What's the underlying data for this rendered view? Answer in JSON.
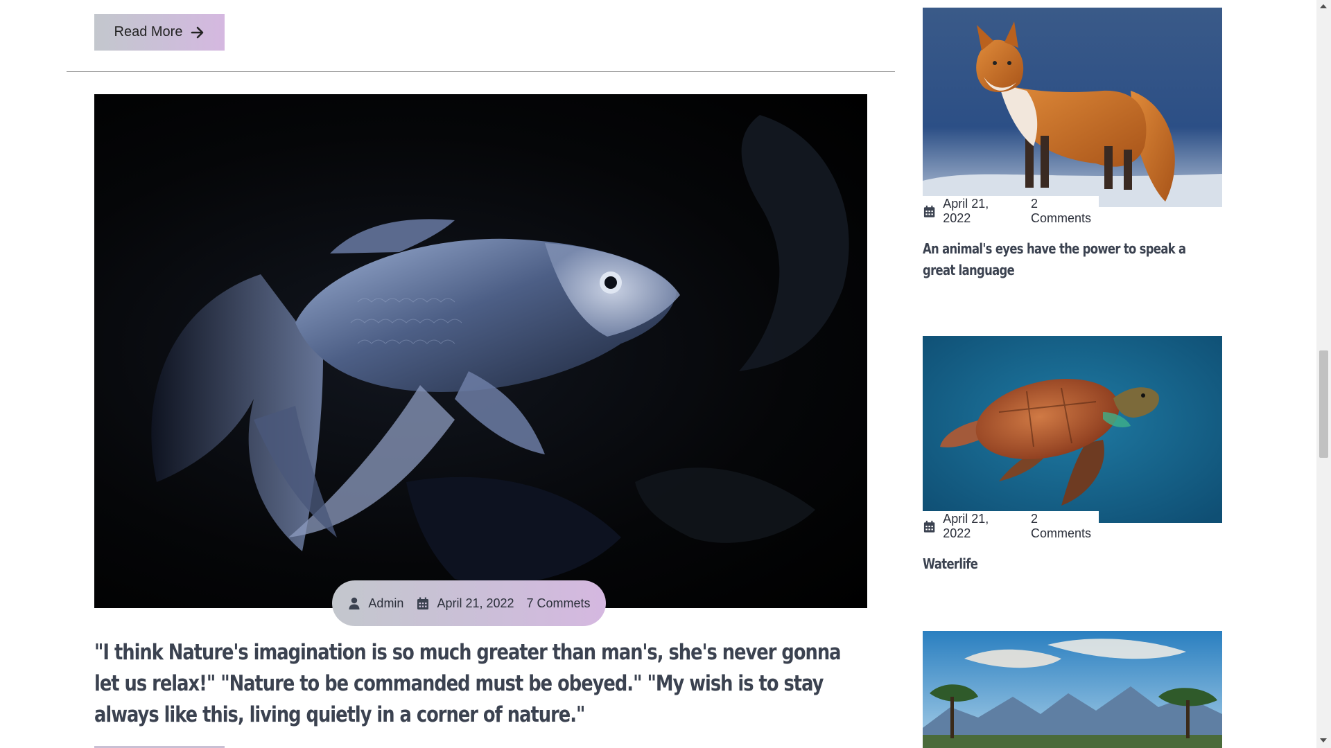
{
  "main": {
    "read_more_label": "Read More",
    "post": {
      "author": "Admin",
      "date": "April 21, 2022",
      "comments": "7 Commets",
      "title": "\"I think Nature's imagination is so much greater than man's, she's never gonna let us relax!\" \"Nature to be commanded must be obeyed.\" \"My wish is to stay always like this, living quietly in a corner of nature.\""
    }
  },
  "sidebar": {
    "cards": [
      {
        "date": "April 21, 2022",
        "comments": "2 Comments",
        "title": "An animal's eyes have the power to speak a great language"
      },
      {
        "date": "April 21, 2022",
        "comments": "2 Comments",
        "title": "Waterlife"
      },
      {
        "date": "",
        "comments": "",
        "title": ""
      }
    ]
  },
  "colors": {
    "accent_gradient_start": "#c3c7cd",
    "accent_gradient_end": "#d5b8e0",
    "text_dark": "#3b4250"
  },
  "icons": {
    "arrow": "arrow-right-icon",
    "user": "user-icon",
    "calendar": "calendar-icon"
  }
}
